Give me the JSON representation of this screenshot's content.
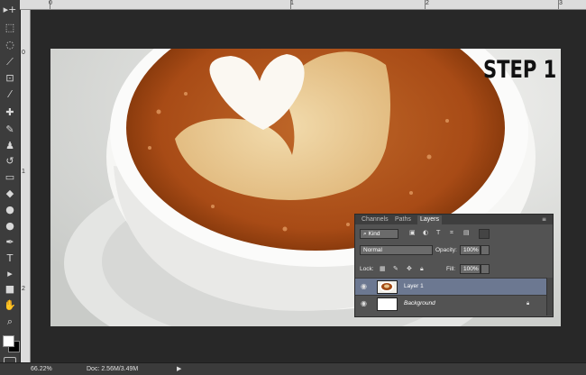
{
  "rulers": {
    "top": [
      "0",
      "1",
      "2",
      "3"
    ],
    "left": [
      "0",
      "1",
      "2"
    ]
  },
  "toolbar": {
    "tools": [
      "move-tool",
      "marquee-tool",
      "lasso-tool",
      "quick-select-tool",
      "crop-tool",
      "eyedropper-tool",
      "healing-brush-tool",
      "brush-tool",
      "clone-stamp-tool",
      "history-brush-tool",
      "eraser-tool",
      "paint-bucket-tool",
      "blur-tool",
      "dodge-tool",
      "pen-tool",
      "type-tool",
      "path-selection-tool",
      "shape-tool",
      "hand-tool",
      "zoom-tool"
    ],
    "icons": [
      "▸+",
      "⬚",
      "◌",
      "⟋",
      "⊡",
      "⁄",
      "✚",
      "✎",
      "♟",
      "↺",
      "▭",
      "◆",
      "●",
      "●",
      "✒",
      "T",
      "▸",
      "■",
      "✋",
      "⌕"
    ]
  },
  "canvas": {
    "overlay_text": "STEP 1"
  },
  "layers_panel": {
    "tabs": [
      "Channels",
      "Paths",
      "Layers"
    ],
    "active_tab": "Layers",
    "filter_kind": "Kind",
    "blend_mode": "Normal",
    "opacity_label": "Opacity:",
    "opacity_value": "100%",
    "lock_label": "Lock:",
    "fill_label": "Fill:",
    "fill_value": "100%",
    "layers": [
      {
        "name": "Layer 1",
        "selected": true
      },
      {
        "name": "Background",
        "selected": false,
        "locked": true
      }
    ]
  },
  "status_bar": {
    "zoom": "66.22%",
    "doc": "Doc: 2.56M/3.49M"
  },
  "colors": {
    "foreground": "#ffffff",
    "background": "#000000",
    "selected_layer": "#6c7891"
  }
}
